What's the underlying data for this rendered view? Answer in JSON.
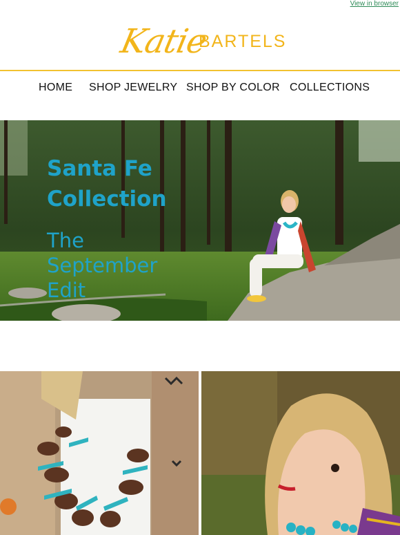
{
  "topbar": {
    "view_in_browser": "View in browser"
  },
  "logo": {
    "script_text": "Katie",
    "brand_text": "BARTELS"
  },
  "nav": {
    "items": [
      {
        "label": "HOME"
      },
      {
        "label": "SHOP JEWELRY"
      },
      {
        "label": "SHOP BY COLOR"
      },
      {
        "label": "COLLECTIONS"
      }
    ]
  },
  "hero": {
    "title_line1": "Santa Fe",
    "title_line2": "Collection",
    "subtitle": "The September Edit"
  },
  "colors": {
    "accent": "#f2b51b",
    "hero_text": "#1fa3c9",
    "link": "#2e8b57"
  }
}
